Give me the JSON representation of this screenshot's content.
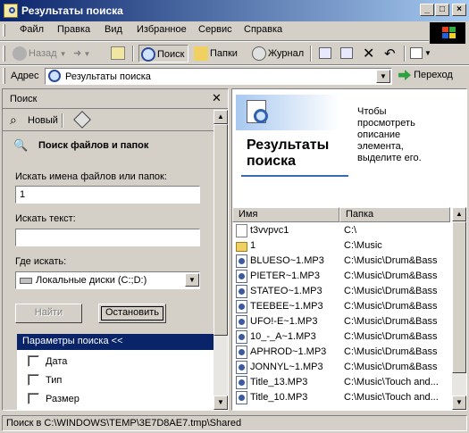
{
  "window": {
    "title": "Результаты поиска"
  },
  "menu": [
    "Файл",
    "Правка",
    "Вид",
    "Избранное",
    "Сервис",
    "Справка"
  ],
  "toolbar": {
    "back": "Назад",
    "search": "Поиск",
    "folders": "Папки",
    "history": "Журнал"
  },
  "address": {
    "label": "Адрес",
    "value": "Результаты поиска",
    "go": "Переход"
  },
  "search_pane": {
    "title": "Поиск",
    "new_label": "Новый",
    "heading": "Поиск файлов и папок",
    "filename_label": "Искать имена файлов или папок:",
    "filename_value": "1",
    "text_label": "Искать текст:",
    "text_value": "",
    "where_label": "Где искать:",
    "where_value": "Локальные диски (C:;D:)",
    "find_button": "Найти",
    "stop_button": "Остановить",
    "params_title": "Параметры поиска <<",
    "options": [
      "Дата",
      "Тип",
      "Размер"
    ]
  },
  "results": {
    "banner_title": "Результаты поиска",
    "banner_hint": "Чтобы просмотреть описание элемента, выделите его.",
    "columns": [
      "Имя",
      "Папка"
    ],
    "rows": [
      {
        "name": "t3vvpvc1",
        "folder": "C:\\",
        "kind": "file"
      },
      {
        "name": "1",
        "folder": "C:\\Music",
        "kind": "folder"
      },
      {
        "name": "BLUESO~1.MP3",
        "folder": "C:\\Music\\Drum&Bass",
        "kind": "mp3"
      },
      {
        "name": "PIETER~1.MP3",
        "folder": "C:\\Music\\Drum&Bass",
        "kind": "mp3"
      },
      {
        "name": "STATEO~1.MP3",
        "folder": "C:\\Music\\Drum&Bass",
        "kind": "mp3"
      },
      {
        "name": "TEEBEE~1.MP3",
        "folder": "C:\\Music\\Drum&Bass",
        "kind": "mp3"
      },
      {
        "name": "UFO!-E~1.MP3",
        "folder": "C:\\Music\\Drum&Bass",
        "kind": "mp3"
      },
      {
        "name": "10_-_A~1.MP3",
        "folder": "C:\\Music\\Drum&Bass",
        "kind": "mp3"
      },
      {
        "name": "APHROD~1.MP3",
        "folder": "C:\\Music\\Drum&Bass",
        "kind": "mp3"
      },
      {
        "name": "JONNYL~1.MP3",
        "folder": "C:\\Music\\Drum&Bass",
        "kind": "mp3"
      },
      {
        "name": "Title_13.MP3",
        "folder": "C:\\Music\\Touch and...",
        "kind": "mp3"
      },
      {
        "name": "Title_10.MP3",
        "folder": "C:\\Music\\Touch and...",
        "kind": "mp3"
      }
    ]
  },
  "status": {
    "text": "Поиск в C:\\WINDOWS\\TEMP\\3E7D8AE7.tmp\\Shared"
  },
  "colors": {
    "titlebar": "#0a246a",
    "face": "#d4d0c8",
    "selection": "#0a246a"
  }
}
